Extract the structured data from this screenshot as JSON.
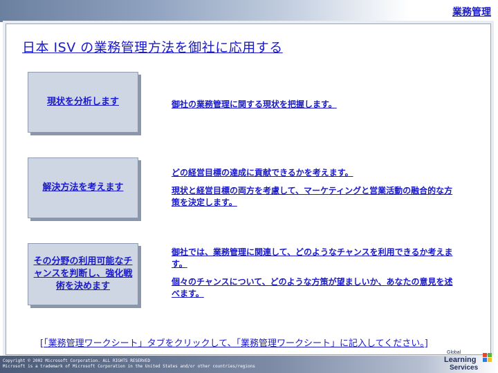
{
  "header": {
    "title": "業務管理"
  },
  "slide": {
    "heading": "日本 ISV の業務管理方法を御社に応用する",
    "rows": [
      {
        "box": "現状を分析します",
        "desc": [
          "御社の業務管理に関する現状を把握します。"
        ]
      },
      {
        "box": "解決方法を考えます",
        "desc": [
          "どの経営目標の達成に貢献できるかを考えます。",
          "現状と経営目標の両方を考慮して、マーケティングと営業活動の融合的な方策を決定します。"
        ]
      },
      {
        "box": "その分野の利用可能なチャンスを判断し、強化戦術を決めます",
        "desc": [
          "御社では、業務管理に関連して、どのようなチャンスを利用できるか考えます。",
          "個々のチャンスについて、どのような方策が望ましいか、あなたの意見を述べます。"
        ]
      }
    ],
    "footer_note": "[「業務管理ワークシート」タブをクリックして、「業務管理ワークシート」に記入してください。]"
  },
  "footer": {
    "copyright_line1": "Copyright © 2002 Microsoft Corporation. ALL RIGHTS RESERVED",
    "copyright_line2": "Microsoft is a trademark of Microsoft Corporation in the United States and/or other countries/regions",
    "logo_line1": "Global",
    "logo_line2": "Learning",
    "logo_line3": "Services"
  },
  "colors": {
    "text": "#1a1ac8",
    "box_fill": "#cfd6e3"
  }
}
